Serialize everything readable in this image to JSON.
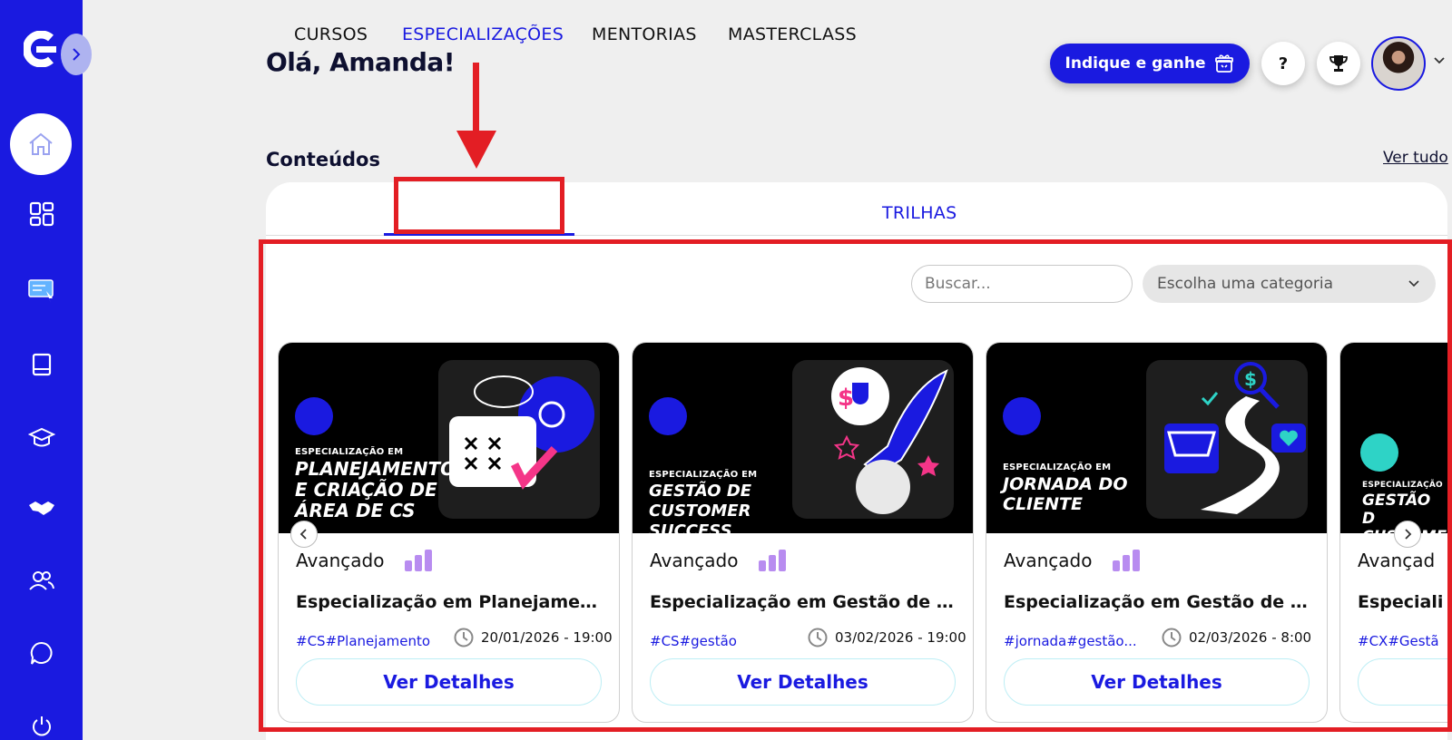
{
  "header": {
    "greeting": "Olá, Amanda!",
    "refer_label": "Indique e ganhe",
    "help_label": "?"
  },
  "sidebar": {
    "items": [
      {
        "icon": "home-icon"
      },
      {
        "icon": "dashboard-icon"
      },
      {
        "icon": "certificate-icon"
      },
      {
        "icon": "book-icon"
      },
      {
        "icon": "graduation-cap-icon"
      },
      {
        "icon": "handshake-icon"
      },
      {
        "icon": "users-icon"
      },
      {
        "icon": "chat-icon"
      },
      {
        "icon": "power-icon"
      }
    ]
  },
  "section": {
    "title": "Conteúdos",
    "see_all": "Ver tudo"
  },
  "tabs": [
    {
      "label": "CURSOS"
    },
    {
      "label": "ESPECIALIZAÇÕES",
      "active": true
    },
    {
      "label": "MENTORIAS"
    },
    {
      "label": "MASTERCLASS"
    },
    {
      "label": "TRILHAS"
    }
  ],
  "filters": {
    "search_placeholder": "Buscar...",
    "category_placeholder": "Escolha uma categoria"
  },
  "cards": [
    {
      "image_sub": "ESPECIALIZAÇÃO EM",
      "image_main": "PLANEJAMENTO E CRIAÇÃO DE ÁREA DE CS",
      "level": "Avançado",
      "title": "Especialização em Planejament...",
      "tags": "#CS#Planejamento",
      "date": "20/01/2026 - 19:00",
      "button": "Ver Detalhes"
    },
    {
      "image_sub": "ESPECIALIZAÇÃO EM",
      "image_main": "GESTÃO DE CUSTOMER SUCCESS",
      "level": "Avançado",
      "title": "Especialização em Gestão de C...",
      "tags": "#CS#gestão",
      "date": "03/02/2026 - 19:00",
      "button": "Ver Detalhes"
    },
    {
      "image_sub": "ESPECIALIZAÇÃO EM",
      "image_main": "JORNADA DO CLIENTE",
      "level": "Avançado",
      "title": "Especialização em Gestão de Jo...",
      "tags": "#jornada#gestão...",
      "date": "02/03/2026 - 8:00",
      "button": "Ver Detalhes"
    },
    {
      "image_sub": "ESPECIALIZAÇÃO",
      "image_main": "GESTÃO D CUSTOME",
      "level": "Avançad",
      "title": "Especiali",
      "tags": "#CX#Gestã",
      "date": "",
      "button": ""
    }
  ],
  "colors": {
    "brand": "#1a1ae0",
    "annotation": "#e31e24",
    "level_bars": "#b88cf0"
  }
}
